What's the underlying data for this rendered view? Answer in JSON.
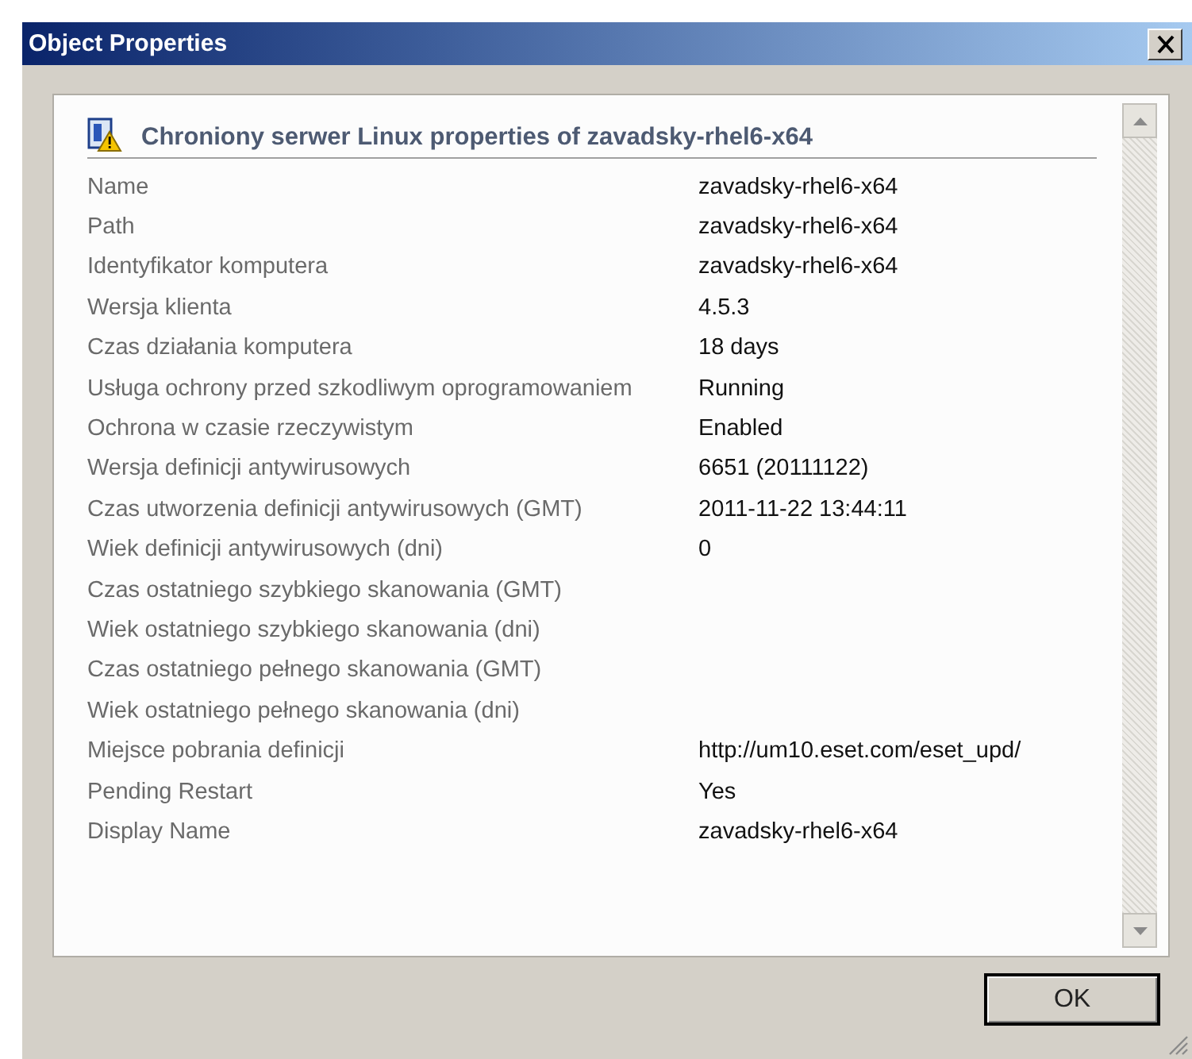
{
  "window": {
    "title": "Object Properties"
  },
  "header": {
    "title": "Chroniony serwer Linux properties of zavadsky-rhel6-x64"
  },
  "properties": [
    {
      "label": "Name",
      "value": "zavadsky-rhel6-x64"
    },
    {
      "label": "Path",
      "value": "zavadsky-rhel6-x64"
    },
    {
      "label": "Identyfikator komputera",
      "value": "zavadsky-rhel6-x64"
    },
    {
      "label": "Wersja klienta",
      "value": "4.5.3"
    },
    {
      "label": "Czas działania komputera",
      "value": "18 days"
    },
    {
      "label": "Usługa ochrony przed szkodliwym oprogramowaniem",
      "value": "Running"
    },
    {
      "label": "Ochrona w czasie rzeczywistym",
      "value": "Enabled"
    },
    {
      "label": "Wersja definicji antywirusowych",
      "value": "6651 (20111122)"
    },
    {
      "label": "Czas utworzenia definicji antywirusowych (GMT)",
      "value": "2011-11-22 13:44:11"
    },
    {
      "label": "Wiek definicji antywirusowych (dni)",
      "value": "0"
    },
    {
      "label": "Czas ostatniego szybkiego skanowania (GMT)"
    },
    {
      "label": "Wiek ostatniego szybkiego skanowania (dni)"
    },
    {
      "label": "Czas ostatniego pełnego skanowania (GMT)"
    },
    {
      "label": "Wiek ostatniego pełnego skanowania (dni)"
    },
    {
      "label": "Miejsce pobrania definicji",
      "value": "http://um10.eset.com/eset_upd/"
    },
    {
      "label": "Pending Restart",
      "value": "Yes"
    },
    {
      "label": "Display Name",
      "value": "zavadsky-rhel6-x64"
    }
  ],
  "buttons": [
    "OK"
  ]
}
